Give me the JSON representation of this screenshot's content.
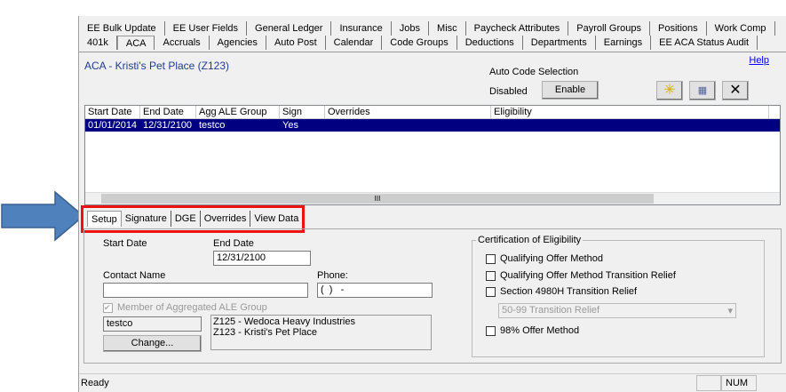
{
  "tabs_row1": [
    "EE Bulk Update",
    "EE User Fields",
    "General Ledger",
    "Insurance",
    "Jobs",
    "Misc",
    "Paycheck Attributes",
    "Payroll Groups",
    "Positions",
    "Work Comp"
  ],
  "tabs_row2": [
    "401k",
    "ACA",
    "Accruals",
    "Agencies",
    "Auto Post",
    "Calendar",
    "Code Groups",
    "Deductions",
    "Departments",
    "Earnings",
    "EE ACA Status Audit"
  ],
  "active_tab": "ACA",
  "help_link": "Help",
  "page_title": "ACA - Kristi's Pet Place (Z123)",
  "auto_code": {
    "label": "Auto Code Selection",
    "status": "Disabled",
    "button": "Enable"
  },
  "toolbar": {
    "new_icon": "asterisk-icon",
    "edit_icon": "edit-record-icon",
    "delete_icon": "x-icon"
  },
  "grid": {
    "columns": [
      "Start Date",
      "End Date",
      "Agg ALE Group",
      "Sign",
      "Overrides",
      "Eligibility"
    ],
    "rows": [
      [
        "01/01/2014",
        "12/31/2100",
        "testco",
        "Yes",
        "",
        ""
      ]
    ],
    "scroll_thumb": "III"
  },
  "subtabs": [
    "Setup",
    "Signature",
    "DGE",
    "Overrides",
    "View Data"
  ],
  "active_subtab": "Setup",
  "form": {
    "start_date_label": "Start Date",
    "end_date_label": "End Date",
    "end_date": "12/31/2100",
    "contact_label": "Contact Name",
    "contact": "",
    "phone_label": "Phone:",
    "phone": "(  )   -",
    "member_label": "Member of Aggregated ALE Group",
    "member_checked": true,
    "group": "testco",
    "change_button": "Change...",
    "members": [
      "Z125 - Wedoca Heavy Industries",
      "Z123 - Kristi's Pet Place"
    ]
  },
  "certification": {
    "title": "Certification of Eligibility",
    "options": [
      "Qualifying Offer Method",
      "Qualifying Offer Method Transition Relief",
      "Section 4980H Transition Relief"
    ],
    "relief_select": "50-99 Transition Relief",
    "offer98": "98% Offer Method"
  },
  "status": {
    "text": "Ready",
    "num": "NUM"
  },
  "colors": {
    "highlight": "#ee1111",
    "arrow": "#4f81bd",
    "selected_row": "#000080"
  }
}
